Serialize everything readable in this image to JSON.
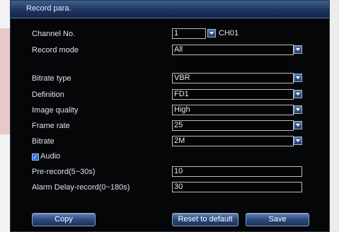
{
  "window": {
    "title": "Record para."
  },
  "channel": {
    "label": "Channel No.",
    "value": "1",
    "name": "CH01"
  },
  "record_mode": {
    "label": "Record mode",
    "value": "All"
  },
  "bitrate_type": {
    "label": "Bitrate type",
    "value": "VBR"
  },
  "definition": {
    "label": "Definition",
    "value": "FD1"
  },
  "image_quality": {
    "label": "Image quality",
    "value": "High"
  },
  "frame_rate": {
    "label": "Frame rate",
    "value": "25"
  },
  "bitrate": {
    "label": "Bitrate",
    "value": "2M"
  },
  "audio": {
    "label": "Audio",
    "checked": true
  },
  "pre_record": {
    "label": "Pre-record(5~30s)",
    "value": "10"
  },
  "alarm_delay": {
    "label": "Alarm Delay-record(0~180s)",
    "value": "30"
  },
  "buttons": {
    "copy": "Copy",
    "reset": "Reset to default",
    "save": "Save"
  },
  "colors": {
    "panel_bg": "#050608",
    "title_bar": "#1e3560",
    "button": "#2c4a7e",
    "text": "#dfe3ea"
  }
}
